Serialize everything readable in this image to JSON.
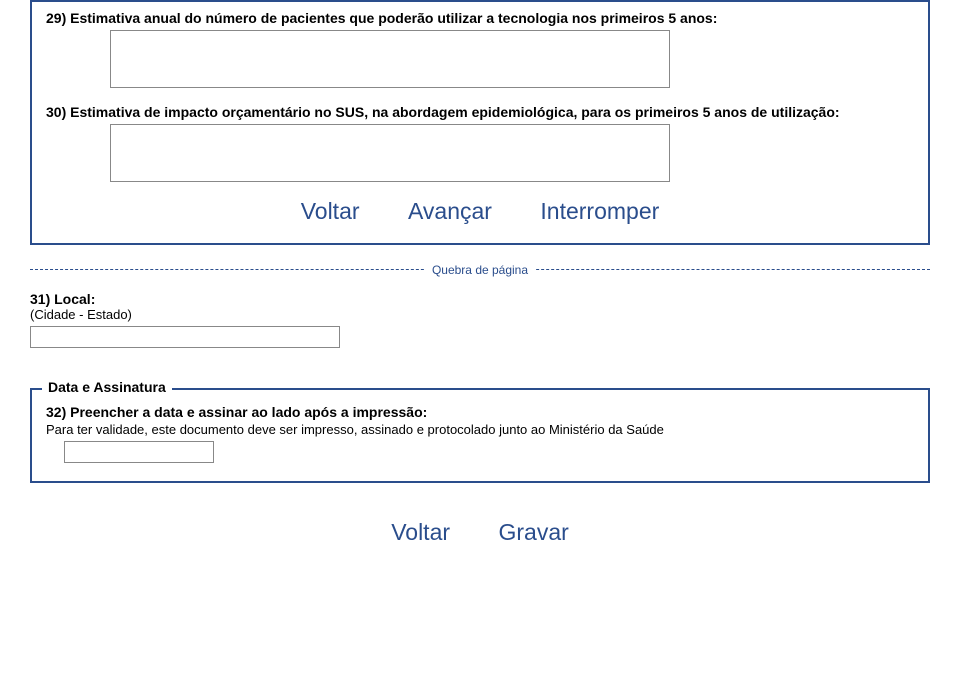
{
  "section1": {
    "q29": "29) Estimativa anual do número de pacientes que poderão utilizar a tecnologia nos primeiros 5 anos:",
    "q30": "30) Estimativa de impacto orçamentário no SUS, na abordagem epidemiológica, para os primeiros 5 anos de utilização:",
    "nav": {
      "voltar": "Voltar",
      "avancar": "Avançar",
      "interromper": "Interromper"
    }
  },
  "page_break": "Quebra de página",
  "local": {
    "title": "31) Local:",
    "sub": "(Cidade - Estado)"
  },
  "signature": {
    "legend": "Data e Assinatura",
    "q32": "32) Preencher a data e assinar ao lado após a impressão:",
    "note": "Para ter validade, este documento deve ser impresso, assinado e protocolado junto ao Ministério da Saúde"
  },
  "bottom": {
    "voltar": "Voltar",
    "gravar": "Gravar"
  }
}
